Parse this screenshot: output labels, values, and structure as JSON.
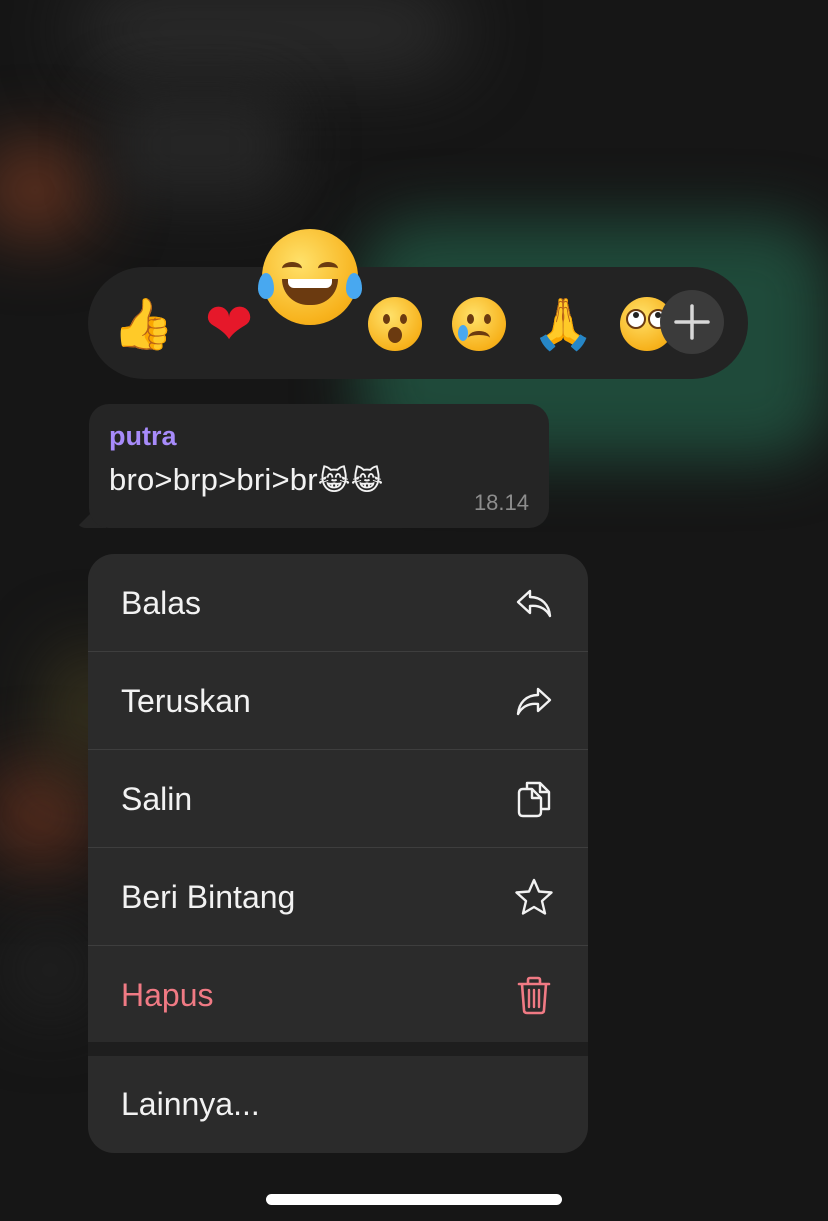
{
  "reactions": {
    "emojis": [
      "👍",
      "❤",
      "😂",
      "😮",
      "😢",
      "🙏",
      "🙄"
    ],
    "icons": [
      "thumbs-up-icon",
      "heart-icon",
      "tears-of-joy-icon",
      "surprised-icon",
      "crying-icon",
      "praying-hands-icon",
      "eye-roll-icon"
    ],
    "add_icon": "plus-icon"
  },
  "message": {
    "sender": "putra",
    "text": "bro>brp>bri>br",
    "emoji": "😹😹",
    "time": "18.14",
    "sender_color": "#a78bfa"
  },
  "menu": {
    "items": [
      {
        "label": "Balas",
        "icon": "reply-icon"
      },
      {
        "label": "Teruskan",
        "icon": "forward-icon"
      },
      {
        "label": "Salin",
        "icon": "copy-icon"
      },
      {
        "label": "Beri Bintang",
        "icon": "star-icon"
      },
      {
        "label": "Hapus",
        "icon": "trash-icon",
        "color": "#f07a84"
      }
    ],
    "more_label": "Lainnya..."
  }
}
